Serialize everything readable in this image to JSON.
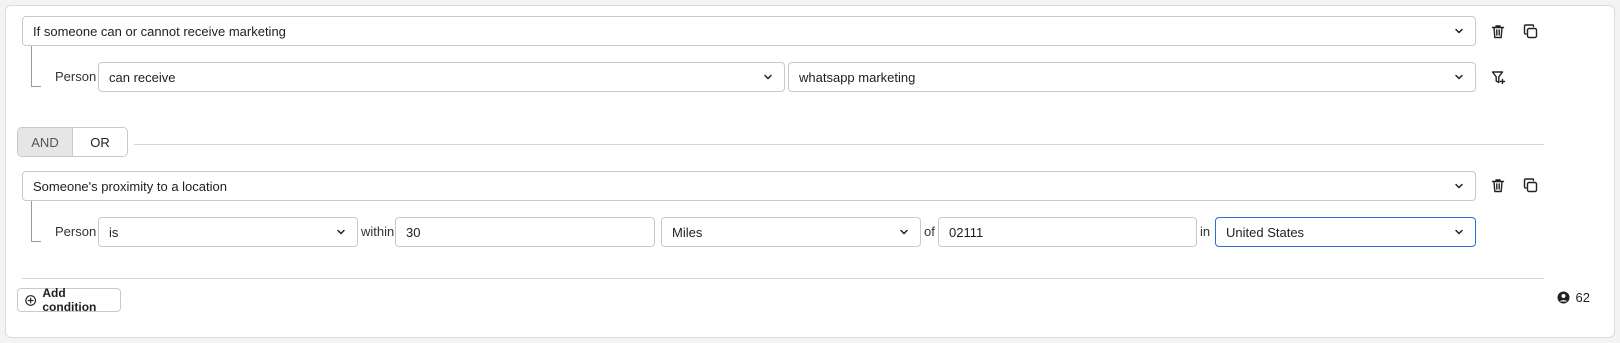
{
  "condition1": {
    "type_value": "If someone can or cannot receive marketing",
    "subject_label": "Person",
    "operator_value": "can receive",
    "channel_value": "whatsapp marketing"
  },
  "logic": {
    "options": [
      "AND",
      "OR"
    ],
    "selected": "AND"
  },
  "condition2": {
    "type_value": "Someone's proximity to a location",
    "subject_label": "Person",
    "operator_value": "is",
    "within_label": "within",
    "distance_value": "30",
    "unit_value": "Miles",
    "of_label": "of",
    "postal_value": "02111",
    "in_label": "in",
    "country_value": "United States"
  },
  "footer": {
    "add_condition_label": "Add condition",
    "profile_count": "62"
  },
  "icons": {
    "delete": "trash-icon",
    "duplicate": "copy-icon",
    "filter": "filter-add-icon",
    "chevron": "chevron-down-icon",
    "add": "plus-circle-icon",
    "profile": "user-circle-icon"
  },
  "colors": {
    "focus_border": "#2b6fd6",
    "active_segment": "#e6e6e6",
    "border": "#c9c9c9"
  }
}
